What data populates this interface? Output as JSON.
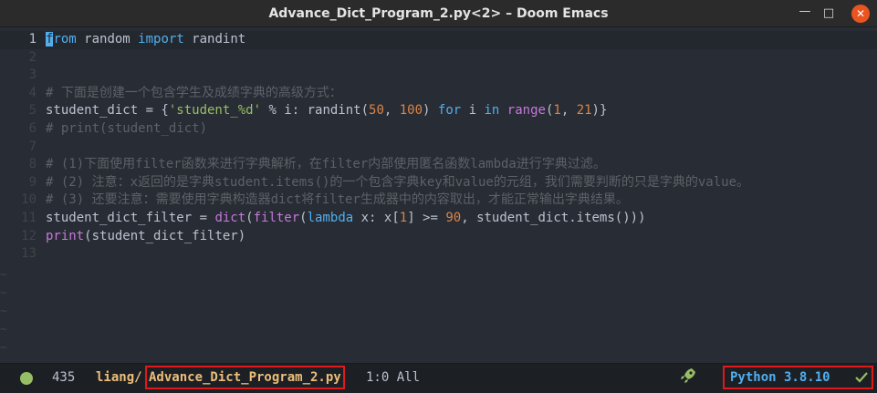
{
  "window": {
    "title": "Advance_Dict_Program_2.py<2> – Doom Emacs",
    "minimize_icon": "minimize-icon",
    "maximize_icon": "maximize-icon",
    "close_icon": "close-icon"
  },
  "editor": {
    "lines": [
      {
        "n": "1",
        "tokens": [
          [
            "cursor",
            "f"
          ],
          [
            "kw",
            "rom"
          ],
          [
            "plain",
            " random "
          ],
          [
            "kw",
            "import"
          ],
          [
            "plain",
            " randint"
          ]
        ]
      },
      {
        "n": "2",
        "tokens": []
      },
      {
        "n": "3",
        "tokens": []
      },
      {
        "n": "4",
        "tokens": [
          [
            "cmt",
            "# 下面是创建一个包含学生及成绩字典的高级方式："
          ]
        ]
      },
      {
        "n": "5",
        "tokens": [
          [
            "plain",
            "student_dict = {"
          ],
          [
            "str",
            "'student_%d'"
          ],
          [
            "plain",
            " % i: randint("
          ],
          [
            "num",
            "50"
          ],
          [
            "plain",
            ", "
          ],
          [
            "num",
            "100"
          ],
          [
            "plain",
            ") "
          ],
          [
            "kw",
            "for"
          ],
          [
            "plain",
            " i "
          ],
          [
            "kw",
            "in"
          ],
          [
            "plain",
            " "
          ],
          [
            "fn",
            "range"
          ],
          [
            "plain",
            "("
          ],
          [
            "num",
            "1"
          ],
          [
            "plain",
            ", "
          ],
          [
            "num",
            "21"
          ],
          [
            "plain",
            ")}"
          ]
        ]
      },
      {
        "n": "6",
        "tokens": [
          [
            "cmt",
            "# print(student_dict)"
          ]
        ]
      },
      {
        "n": "7",
        "tokens": []
      },
      {
        "n": "8",
        "tokens": [
          [
            "cmt",
            "# (1)下面使用filter函数来进行字典解析，在filter内部使用匿名函数lambda进行字典过滤。"
          ]
        ]
      },
      {
        "n": "9",
        "tokens": [
          [
            "cmt",
            "# (2) 注意：x返回的是字典student.items()的一个包含字典key和value的元组，我们需要判断的只是字典的value。"
          ]
        ]
      },
      {
        "n": "10",
        "tokens": [
          [
            "cmt",
            "# (3) 还要注意：需要使用字典构造器dict将filter生成器中的内容取出，才能正常输出字典结果。"
          ]
        ]
      },
      {
        "n": "11",
        "tokens": [
          [
            "plain",
            "student_dict_filter = "
          ],
          [
            "fn",
            "dict"
          ],
          [
            "plain",
            "("
          ],
          [
            "fn",
            "filter"
          ],
          [
            "plain",
            "("
          ],
          [
            "kw",
            "lambda"
          ],
          [
            "plain",
            " x: x["
          ],
          [
            "num",
            "1"
          ],
          [
            "plain",
            "] >= "
          ],
          [
            "num",
            "90"
          ],
          [
            "plain",
            ", student_dict.items()))"
          ]
        ]
      },
      {
        "n": "12",
        "tokens": [
          [
            "fn",
            "print"
          ],
          [
            "plain",
            "(student_dict_filter)"
          ]
        ]
      },
      {
        "n": "13",
        "tokens": []
      }
    ],
    "tilde": "~",
    "tilde_count": 5
  },
  "modeline": {
    "status_icon": "buffer-status-dot-icon",
    "status_color": "#98be65",
    "size": "435",
    "dir": "liang/",
    "buffer_name": "Advance_Dict_Program_2.py",
    "position": "1:0 All",
    "lsp_icon": "rocket-icon",
    "major_mode": "Python 3.8.10",
    "checker_icon": "checkmark-icon"
  },
  "colors": {
    "background": "#282c34",
    "keyword": "#51afef",
    "builtin": "#c678dd",
    "string": "#98be65",
    "number": "#da8548",
    "comment": "#5b6268",
    "highlight_box": "#e01a1a"
  }
}
